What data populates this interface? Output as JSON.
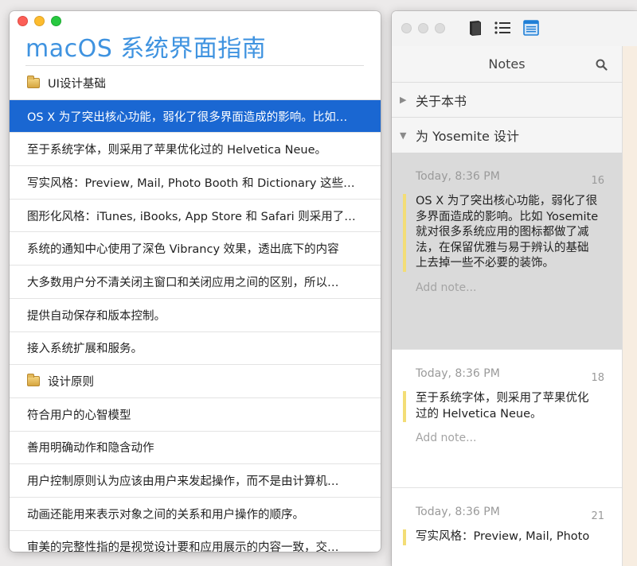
{
  "left": {
    "title": "macOS 系统界面指南",
    "toc": [
      {
        "text": "UI设计基础",
        "section": true
      },
      {
        "text": "OS X 为了突出核心功能，弱化了很多界面造成的影响。比如…",
        "selected": true
      },
      {
        "text": "至于系统字体，则采用了苹果优化过的 Helvetica Neue。"
      },
      {
        "text": "写实风格：Preview, Mail, Photo Booth 和 Dictionary 这些系…"
      },
      {
        "text": "图形化风格：iTunes, iBooks, App Store 和 Safari 则采用了…"
      },
      {
        "text": "系统的通知中心使用了深色 Vibrancy 效果，透出底下的内容"
      },
      {
        "text": "大多数用户分不清关闭主窗口和关闭应用之间的区别，所以…"
      },
      {
        "text": "提供自动保存和版本控制。"
      },
      {
        "text": "接入系统扩展和服务。"
      },
      {
        "text": "设计原则",
        "section": true
      },
      {
        "text": "符合用户的心智模型"
      },
      {
        "text": "善用明确动作和隐含动作"
      },
      {
        "text": "用户控制原则认为应该由用户来发起操作，而不是由计算机…"
      },
      {
        "text": "动画还能用来表示对象之间的关系和用户操作的顺序。"
      },
      {
        "text": "审美的完整性指的是视觉设计要和应用展示的内容一致，交…"
      }
    ]
  },
  "right": {
    "toolbar_icons": [
      "book-icon",
      "list-icon",
      "notes-icon"
    ],
    "notes_title": "Notes",
    "chapters": [
      {
        "label": "关于本书",
        "expanded": false
      },
      {
        "label": "为 Yosemite 设计",
        "expanded": true
      }
    ],
    "notes": [
      {
        "time": "Today, 8:36 PM",
        "num": "16",
        "quote": "OS X 为了突出核心功能，弱化了很多界面造成的影响。比如 Yosemite 就对很多系统应用的图标都做了减法，在保留优雅与易于辨认的基础上去掉一些不必要的装饰。",
        "add": "Add note..."
      },
      {
        "time": "Today, 8:36 PM",
        "num": "18",
        "quote": "至于系统字体，则采用了苹果优化过的 Helvetica Neue。",
        "add": "Add note..."
      },
      {
        "time": "Today, 8:36 PM",
        "num": "21",
        "quote": "写实风格：Preview, Mail, Photo",
        "add": ""
      }
    ]
  },
  "colors": {
    "accent": "#3f93e0",
    "selection": "#1a67d2",
    "highlight": "#f3dd76"
  }
}
